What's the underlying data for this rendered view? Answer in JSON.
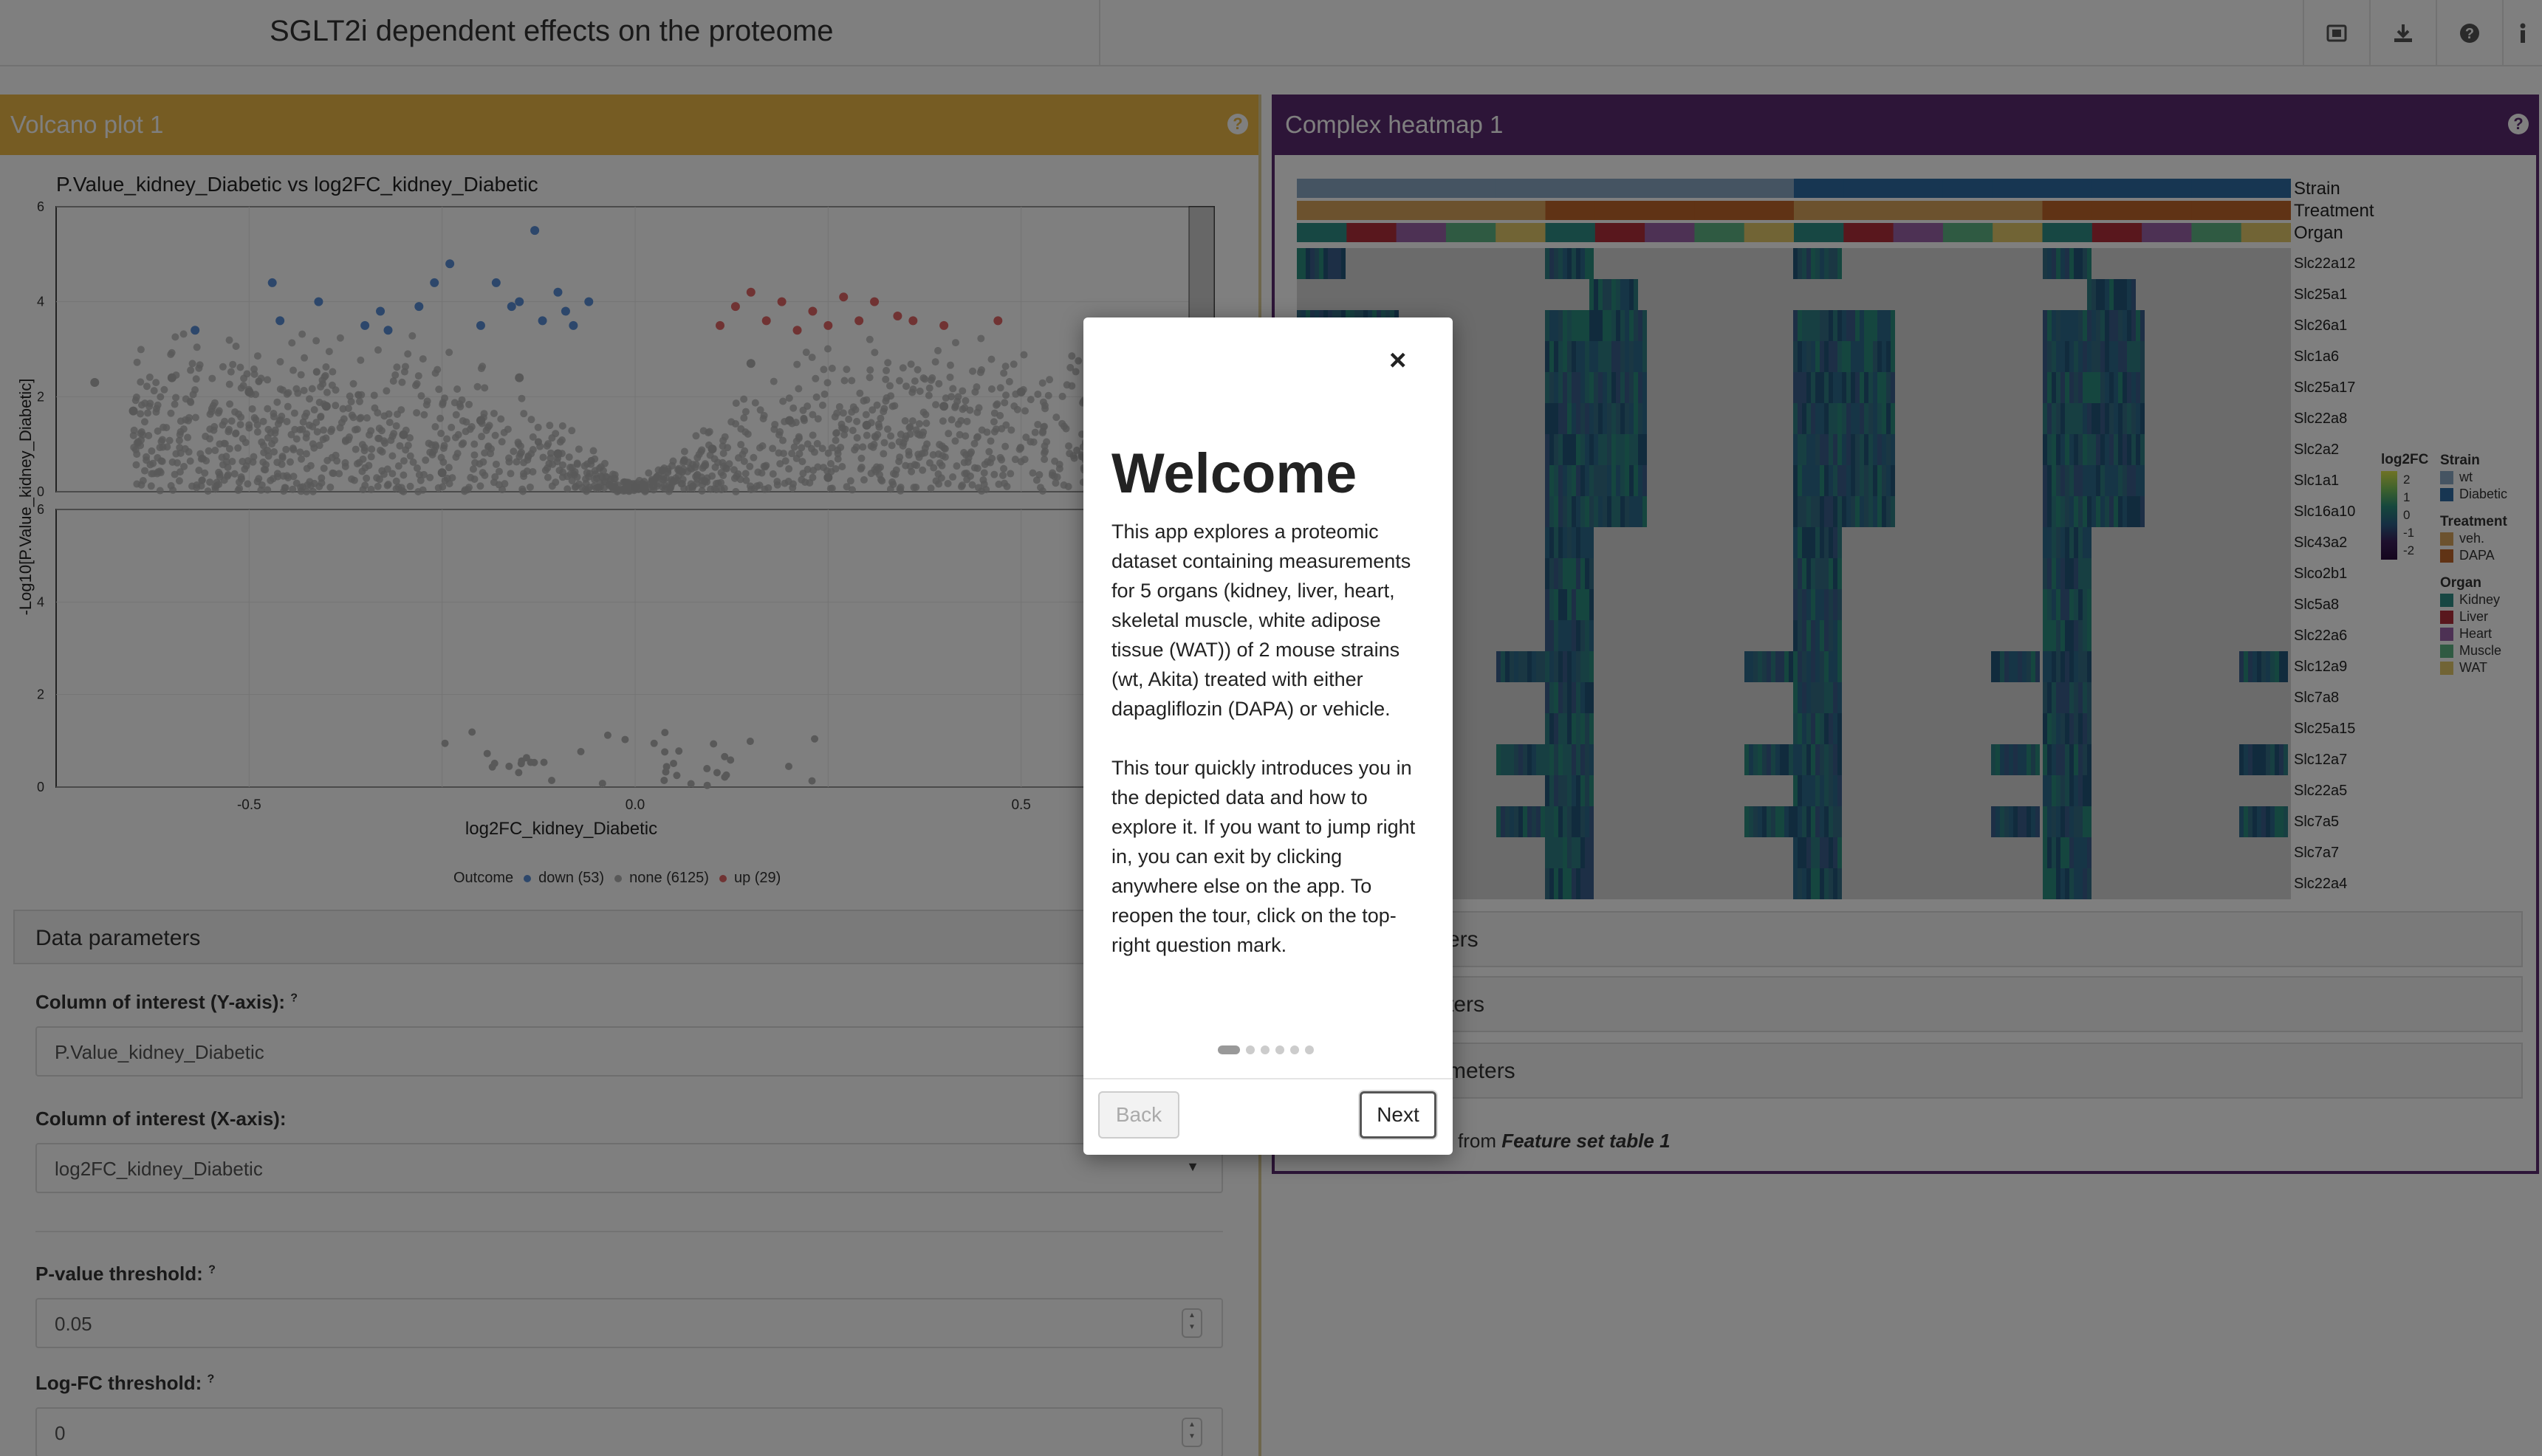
{
  "app": {
    "title": "SGLT2i dependent effects on the proteome"
  },
  "topbar": {
    "icons": [
      "screenshot-icon",
      "download-icon",
      "help-icon",
      "info-icon"
    ]
  },
  "volcano": {
    "header": "Volcano plot 1",
    "plot_title": "P.Value_kidney_Diabetic vs log2FC_kidney_Diabetic",
    "legend": {
      "title": "Outcome",
      "down": "down (53)",
      "none": "none (6125)",
      "up": "up (29)"
    }
  },
  "chart_data": {
    "type": "scatter",
    "title": "P.Value_kidney_Diabetic vs log2FC_kidney_Diabetic",
    "xlabel": "log2FC_kidney_Diabetic",
    "ylabel": "-Log10[P.Value_kidney_Diabetic]",
    "xlim": [
      -0.75,
      0.75
    ],
    "ylim": [
      0,
      6
    ],
    "x_ticks": [
      "-0.5",
      "0.0",
      "0.5"
    ],
    "y_ticks": [
      "0",
      "2",
      "4",
      "6"
    ],
    "series": [
      {
        "name": "down (53)",
        "color": "#5b8fd6",
        "points": [
          [
            -0.57,
            3.4
          ],
          [
            -0.47,
            4.4
          ],
          [
            -0.46,
            3.6
          ],
          [
            -0.41,
            4.0
          ],
          [
            -0.35,
            3.5
          ],
          [
            -0.33,
            3.8
          ],
          [
            -0.32,
            3.4
          ],
          [
            -0.28,
            3.9
          ],
          [
            -0.26,
            4.4
          ],
          [
            -0.24,
            4.8
          ],
          [
            -0.2,
            3.5
          ],
          [
            -0.18,
            4.4
          ],
          [
            -0.16,
            3.9
          ],
          [
            -0.15,
            4.0
          ],
          [
            -0.13,
            5.5
          ],
          [
            -0.12,
            3.6
          ],
          [
            -0.1,
            4.2
          ],
          [
            -0.09,
            3.8
          ],
          [
            -0.08,
            3.5
          ],
          [
            -0.06,
            4.0
          ]
        ]
      },
      {
        "name": "none (6125)",
        "color": "#b0b0b0",
        "points": [
          [
            -0.7,
            2.3
          ],
          [
            -0.6,
            2.4
          ],
          [
            -0.5,
            2.1
          ],
          [
            -0.4,
            1.8
          ],
          [
            -0.3,
            1.2
          ],
          [
            -0.2,
            1.5
          ],
          [
            -0.1,
            0.8
          ],
          [
            0.0,
            0.1
          ],
          [
            0.1,
            0.9
          ],
          [
            0.2,
            1.5
          ],
          [
            0.3,
            1.4
          ],
          [
            0.4,
            1.8
          ],
          [
            0.5,
            2.1
          ],
          [
            0.6,
            2.2
          ],
          [
            0.65,
            1.4
          ],
          [
            -0.65,
            1.7
          ],
          [
            0.25,
            0.3
          ],
          [
            -0.25,
            0.4
          ],
          [
            0.15,
            2.7
          ],
          [
            -0.15,
            2.4
          ]
        ]
      },
      {
        "name": "up (29)",
        "color": "#e06666",
        "points": [
          [
            0.11,
            3.5
          ],
          [
            0.13,
            3.9
          ],
          [
            0.15,
            4.2
          ],
          [
            0.17,
            3.6
          ],
          [
            0.19,
            4.0
          ],
          [
            0.21,
            3.4
          ],
          [
            0.23,
            3.8
          ],
          [
            0.25,
            3.5
          ],
          [
            0.27,
            4.1
          ],
          [
            0.29,
            3.6
          ],
          [
            0.31,
            4.0
          ],
          [
            0.34,
            3.7
          ],
          [
            0.36,
            3.6
          ],
          [
            0.4,
            3.5
          ],
          [
            0.47,
            3.6
          ]
        ]
      }
    ]
  },
  "params": {
    "header": "Data parameters",
    "y_label": "Column of interest (Y-axis):",
    "y_value": "P.Value_kidney_Diabetic",
    "x_label": "Column of interest (X-axis):",
    "x_value": "log2FC_kidney_Diabetic",
    "p_label": "P-value threshold:",
    "p_value": "0.05",
    "fc_label": "Log-FC threshold:",
    "fc_value": "0",
    "help_mark": "?"
  },
  "heatmap": {
    "header": "Complex heatmap 1",
    "annotations": [
      "Strain",
      "Treatment",
      "Organ"
    ],
    "rows": [
      "Slc22a12",
      "Slc25a1",
      "Slc26a1",
      "Slc1a6",
      "Slc25a17",
      "Slc22a8",
      "Slc2a2",
      "Slc1a1",
      "Slc16a10",
      "Slc43a2",
      "Slco2b1",
      "Slc5a8",
      "Slc22a6",
      "Slc12a9",
      "Slc7a8",
      "Slc25a15",
      "Slc12a7",
      "Slc22a5",
      "Slc7a5",
      "Slc7a7",
      "Slc22a4"
    ],
    "legend": {
      "log2fc_title": "log2FC",
      "log2fc_ticks": [
        "2",
        "1",
        "0",
        "-1",
        "-2"
      ],
      "strain_title": "Strain",
      "strain": [
        {
          "label": "wt",
          "color": "#8aa8c4"
        },
        {
          "label": "Diabetic",
          "color": "#2e6da4"
        }
      ],
      "treatment_title": "Treatment",
      "treatment": [
        {
          "label": "veh.",
          "color": "#d9a45c"
        },
        {
          "label": "DAPA",
          "color": "#c1662a"
        }
      ],
      "organ_title": "Organ",
      "organ": [
        {
          "label": "Kidney",
          "color": "#2f8f87"
        },
        {
          "label": "Liver",
          "color": "#b22f3a"
        },
        {
          "label": "Heart",
          "color": "#9a62a8"
        },
        {
          "label": "Muscle",
          "color": "#5fb585"
        },
        {
          "label": "WAT",
          "color": "#e3c86a"
        }
      ]
    },
    "collapsed": [
      "ers",
      "ters",
      "meters"
    ],
    "footer_prefix": "from ",
    "footer_link": "Feature set table 1"
  },
  "modal": {
    "close": "×",
    "title": "Welcome",
    "p1": "This app explores a proteomic dataset containing measurements for 5 organs (kidney, liver, heart, skeletal muscle, white adipose tissue (WAT)) of 2 mouse strains (wt, Akita) treated with either dapagliflozin (DAPA) or vehicle.",
    "p2": "This tour quickly introduces you in the depicted data and how to explore it. If you want to jump right in, you can exit by clicking anywhere else on the app. To reopen the tour, click on the top-right question mark.",
    "back": "Back",
    "next": "Next",
    "steps": 6,
    "current_step": 1
  }
}
